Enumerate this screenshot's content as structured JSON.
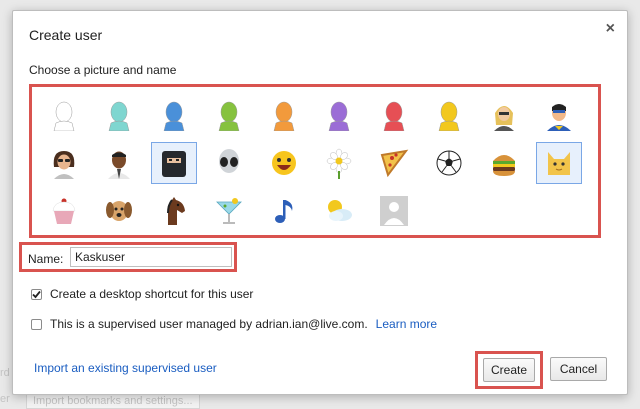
{
  "background": {
    "ghost_a": "er",
    "ghost_b": "rd",
    "ghost_c": "Import bookmarks and settings..."
  },
  "dialog": {
    "title": "Create user",
    "close_glyph": "×",
    "subtitle": "Choose a picture and name"
  },
  "avatars": [
    {
      "name": "avatar-silhouette-white-icon"
    },
    {
      "name": "avatar-silhouette-teal-icon"
    },
    {
      "name": "avatar-silhouette-blue-icon"
    },
    {
      "name": "avatar-silhouette-green-icon"
    },
    {
      "name": "avatar-silhouette-orange-icon"
    },
    {
      "name": "avatar-silhouette-purple-icon"
    },
    {
      "name": "avatar-silhouette-red-icon"
    },
    {
      "name": "avatar-silhouette-yellow-icon"
    },
    {
      "name": "avatar-businesswoman-icon"
    },
    {
      "name": "avatar-superhero-icon"
    },
    {
      "name": "avatar-woman-sunglasses-icon"
    },
    {
      "name": "avatar-man-icon"
    },
    {
      "name": "avatar-ninja-icon",
      "selected": true
    },
    {
      "name": "avatar-alien-icon"
    },
    {
      "name": "avatar-smiley-icon"
    },
    {
      "name": "avatar-flower-icon"
    },
    {
      "name": "avatar-pizza-icon"
    },
    {
      "name": "avatar-soccer-ball-icon"
    },
    {
      "name": "avatar-burger-icon"
    },
    {
      "name": "avatar-cat-icon",
      "selected": true
    },
    {
      "name": "avatar-cupcake-icon"
    },
    {
      "name": "avatar-dog-icon"
    },
    {
      "name": "avatar-horse-icon"
    },
    {
      "name": "avatar-cocktail-icon"
    },
    {
      "name": "avatar-music-note-icon"
    },
    {
      "name": "avatar-weather-icon"
    },
    {
      "name": "avatar-placeholder-photo-icon"
    }
  ],
  "colors": {
    "white": "#e8e8e8",
    "teal": "#7fd6d0",
    "blue": "#4a90d9",
    "green": "#86c23f",
    "orange": "#f29a3c",
    "purple": "#9b6dd6",
    "red": "#e64f55",
    "yellow": "#f2c81e",
    "highlight": "#d9534f",
    "link": "#1a5dc1"
  },
  "name_field": {
    "label": "Name:",
    "value": "Kaskuser"
  },
  "options": {
    "desktop_shortcut": {
      "label": "Create a desktop shortcut for this user",
      "checked": true
    },
    "supervised": {
      "label": "This is a supervised user managed by adrian.ian@live.com.",
      "checked": false,
      "learn_more": "Learn more"
    }
  },
  "import_link": "Import an existing supervised user",
  "buttons": {
    "create": "Create",
    "cancel": "Cancel"
  }
}
